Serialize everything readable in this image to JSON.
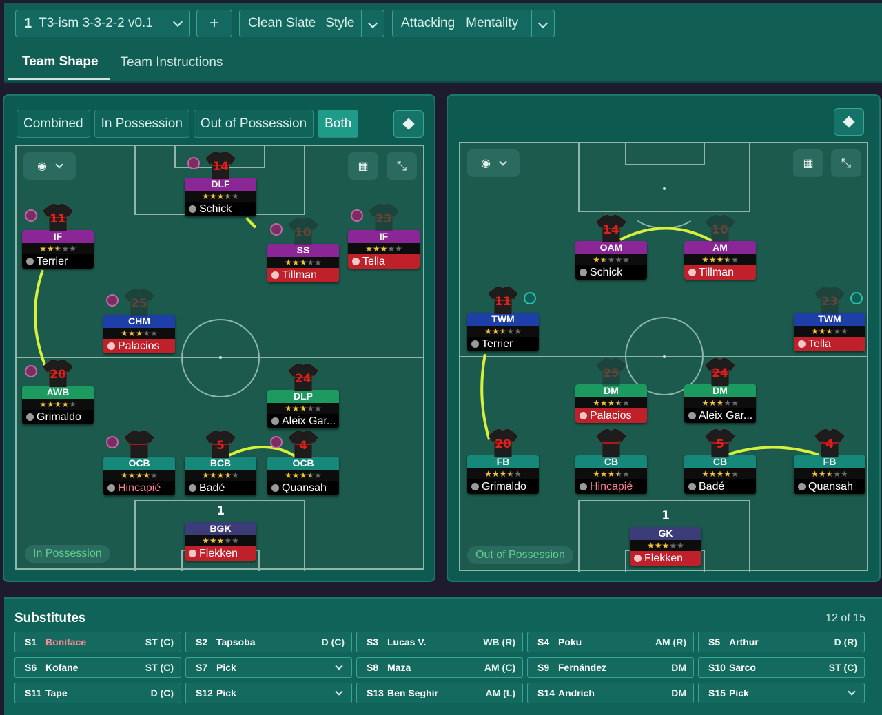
{
  "tactic": {
    "number": "1",
    "name": "T3-ism 3-3-2-2 v0.1",
    "add_label": "+",
    "style_value": "Clean Slate",
    "style_label": "Style",
    "mentality_value": "Attacking",
    "mentality_label": "Mentality"
  },
  "tabs": [
    "Team Shape",
    "Team Instructions"
  ],
  "view_modes": [
    "Combined",
    "In Possession",
    "Out of Possession",
    "Both"
  ],
  "active_view_mode": "Both",
  "in_possession": {
    "label": "In Possession",
    "players": [
      {
        "number": "14",
        "role": "DLF",
        "name": "Schick",
        "stars": 3.5,
        "color": "purple",
        "name_red": false,
        "marker": "left"
      },
      {
        "number": "11",
        "role": "IF",
        "name": "Terrier",
        "stars": 2.5,
        "color": "purple",
        "name_red": false,
        "marker": "left"
      },
      {
        "number": "10",
        "role": "SS",
        "name": "Tillman",
        "stars": 3,
        "color": "purple",
        "name_red": true,
        "marker": "left",
        "ghost": true
      },
      {
        "number": "23",
        "role": "IF",
        "name": "Tella",
        "stars": 3,
        "color": "purple",
        "name_red": true,
        "marker": "left",
        "ghost": true
      },
      {
        "number": "25",
        "role": "CHM",
        "name": "Palacios",
        "stars": 3,
        "color": "blue",
        "name_red": true,
        "marker": "left",
        "ghost": true
      },
      {
        "number": "20",
        "role": "AWB",
        "name": "Grimaldo",
        "stars": 4,
        "color": "green",
        "name_red": false,
        "marker": "left"
      },
      {
        "number": "24",
        "role": "DLP",
        "name": "Aleix Gar...",
        "stars": 3,
        "color": "green",
        "name_red": false
      },
      {
        "number": "",
        "role": "OCB",
        "name": "Hincapié",
        "stars": 4,
        "color": "teal",
        "name_red": false,
        "name_pink": true,
        "marker": "left"
      },
      {
        "number": "5",
        "role": "BCB",
        "name": "Badé",
        "stars": 4,
        "color": "teal",
        "name_red": false
      },
      {
        "number": "4",
        "role": "OCB",
        "name": "Quansah",
        "stars": 3.5,
        "color": "teal",
        "name_red": false,
        "marker": "left"
      },
      {
        "number": "1",
        "role": "BGK",
        "name": "Flekken",
        "stars": 3,
        "color": "navy",
        "name_red": true
      }
    ]
  },
  "out_of_possession": {
    "label": "Out of Possession",
    "players": [
      {
        "number": "14",
        "role": "OAM",
        "name": "Schick",
        "stars": 1.5,
        "color": "purple",
        "name_red": false
      },
      {
        "number": "10",
        "role": "AM",
        "name": "Tillman",
        "stars": 3.5,
        "color": "purple",
        "name_red": true,
        "ghost": true
      },
      {
        "number": "11",
        "role": "TWM",
        "name": "Terrier",
        "stars": 2.5,
        "color": "blue",
        "name_red": false,
        "marker": "right"
      },
      {
        "number": "23",
        "role": "TWM",
        "name": "Tella",
        "stars": 2.5,
        "color": "blue",
        "name_red": true,
        "marker": "right",
        "ghost": true
      },
      {
        "number": "25",
        "role": "DM",
        "name": "Palacios",
        "stars": 3.5,
        "color": "green",
        "name_red": true,
        "ghost": true
      },
      {
        "number": "24",
        "role": "DM",
        "name": "Aleix Gar...",
        "stars": 3,
        "color": "green",
        "name_red": false
      },
      {
        "number": "20",
        "role": "FB",
        "name": "Grimaldo",
        "stars": 3.5,
        "color": "teal",
        "name_red": false
      },
      {
        "number": "",
        "role": "CB",
        "name": "Hincapié",
        "stars": 3.5,
        "color": "teal",
        "name_red": false,
        "name_pink": true
      },
      {
        "number": "5",
        "role": "CB",
        "name": "Badé",
        "stars": 4,
        "color": "teal",
        "name_red": false
      },
      {
        "number": "4",
        "role": "FB",
        "name": "Quansah",
        "stars": 2.5,
        "color": "teal",
        "name_red": false
      },
      {
        "number": "1",
        "role": "GK",
        "name": "Flekken",
        "stars": 3,
        "color": "navy",
        "name_red": true
      }
    ]
  },
  "substitutes": {
    "title": "Substitutes",
    "count": "12 of 15",
    "items": [
      {
        "slot": "S1",
        "name": "Boniface",
        "position": "ST (C)",
        "red": true
      },
      {
        "slot": "S2",
        "name": "Tapsoba",
        "position": "D (C)"
      },
      {
        "slot": "S3",
        "name": "Lucas V.",
        "position": "WB (R)"
      },
      {
        "slot": "S4",
        "name": "Poku",
        "position": "AM (R)"
      },
      {
        "slot": "S5",
        "name": "Arthur",
        "position": "D (R)"
      },
      {
        "slot": "S6",
        "name": "Kofane",
        "position": "ST (C)"
      },
      {
        "slot": "S7",
        "name": "Pick",
        "position": "",
        "dropdown": true
      },
      {
        "slot": "S8",
        "name": "Maza",
        "position": "AM (C)"
      },
      {
        "slot": "S9",
        "name": "Fernández",
        "position": "DM"
      },
      {
        "slot": "S10",
        "name": "Sarco",
        "position": "ST (C)"
      },
      {
        "slot": "S11",
        "name": "Tape",
        "position": "D (C)"
      },
      {
        "slot": "S12",
        "name": "Pick",
        "position": "",
        "dropdown": true
      },
      {
        "slot": "S13",
        "name": "Ben Seghir",
        "position": "AM (L)"
      },
      {
        "slot": "S14",
        "name": "Andrich",
        "position": "DM"
      },
      {
        "slot": "S15",
        "name": "Pick",
        "position": "",
        "dropdown": true
      }
    ]
  }
}
